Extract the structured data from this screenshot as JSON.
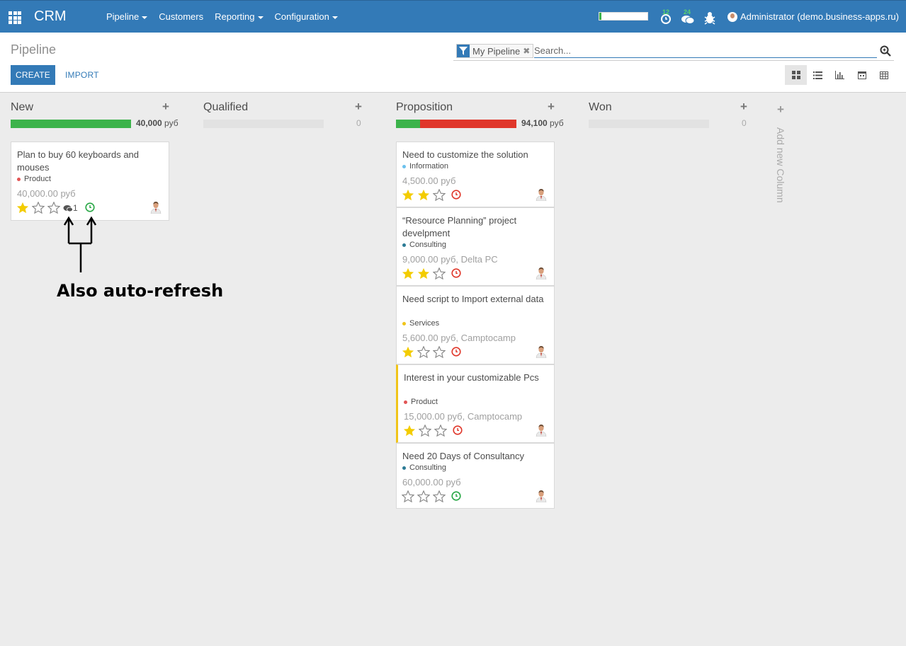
{
  "navbar": {
    "brand": "CRM",
    "menu": [
      "Pipeline",
      "Customers",
      "Reporting",
      "Configuration"
    ],
    "menu_dropdown": [
      true,
      false,
      true,
      true
    ],
    "progress": 0.05,
    "activities_badge": "12",
    "messages_badge": "24",
    "user": "Administrator (demo.business-apps.ru)",
    "accent": "#337ab7"
  },
  "control": {
    "breadcrumb": "Pipeline",
    "create_label": "CREATE",
    "import_label": "IMPORT",
    "facet_label": "My Pipeline",
    "search_placeholder": "Search...",
    "views": [
      "kanban-icon",
      "list-icon",
      "graph-icon",
      "calendar-icon",
      "pivot-icon"
    ]
  },
  "columns": [
    {
      "title": "New",
      "sum": "40,000",
      "currency": "руб",
      "progress": [
        {
          "color": "#3cb34b",
          "share": 1.0
        }
      ]
    },
    {
      "title": "Qualified",
      "sum": "0",
      "currency": "",
      "progress": []
    },
    {
      "title": "Proposition",
      "sum": "94,100",
      "currency": "руб",
      "progress": [
        {
          "color": "#3cb34b",
          "share": 0.2
        },
        {
          "color": "#e0372b",
          "share": 0.8
        }
      ]
    },
    {
      "title": "Won",
      "sum": "0",
      "currency": "",
      "progress": []
    }
  ],
  "cards": [
    {
      "column": 0,
      "title": "Plan to buy 60 keyboards and mouses",
      "tag": "Product",
      "tag_color": "#e25555",
      "amount": "40,000.00 руб",
      "stars": 1,
      "messages": "1",
      "activity": "green",
      "flag": false
    },
    {
      "column": 2,
      "title": "Need to customize the solution",
      "tag": "Information",
      "tag_color": "#6cc1ed",
      "amount": "4,500.00 руб",
      "stars": 2,
      "messages": "",
      "activity": "red",
      "flag": false
    },
    {
      "column": 2,
      "title": "“Resource Planning” project develpment",
      "tag": "Consulting",
      "tag_color": "#2c7b95",
      "amount": "9,000.00 руб, Delta PC",
      "stars": 2,
      "messages": "",
      "activity": "red",
      "flag": false
    },
    {
      "column": 2,
      "title": "Need script to Import external data",
      "tag": "Services",
      "tag_color": "#f0c419",
      "amount": "5,600.00 руб, Camptocamp",
      "stars": 1,
      "messages": "",
      "activity": "red",
      "flag": false
    },
    {
      "column": 2,
      "title": "Interest in your customizable Pcs",
      "tag": "Product",
      "tag_color": "#e25555",
      "amount": "15,000.00 руб, Camptocamp",
      "stars": 1,
      "messages": "",
      "activity": "red",
      "flag": true
    },
    {
      "column": 2,
      "title": "Need 20 Days of Consultancy",
      "tag": "Consulting",
      "tag_color": "#2c7b95",
      "amount": "60,000.00 руб",
      "stars": 0,
      "messages": "",
      "activity": "green",
      "flag": false
    }
  ],
  "add_column": "Add new Column",
  "annotation": "Also auto-refresh"
}
